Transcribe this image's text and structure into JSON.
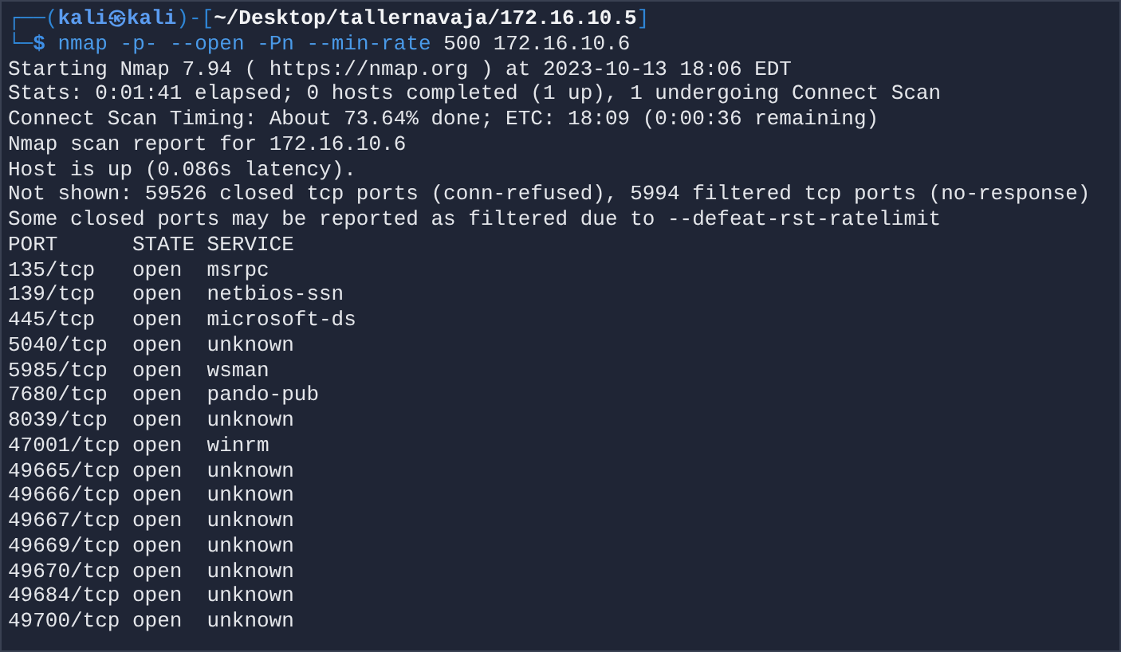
{
  "prompt": {
    "corner_top": "┌──(",
    "user": "kali",
    "at": "㉿",
    "host": "kali",
    "bracket_open": ")-[",
    "path": "~/Desktop/tallernavaja/172.16.10.5",
    "bracket_close": "]",
    "corner_bottom": "└─",
    "symbol": "$"
  },
  "command": {
    "program": "nmap",
    "options": "-p- --open -Pn --min-rate",
    "arguments": "500 172.16.10.6"
  },
  "output": [
    "Starting Nmap 7.94 ( https://nmap.org ) at 2023-10-13 18:06 EDT",
    "Stats: 0:01:41 elapsed; 0 hosts completed (1 up), 1 undergoing Connect Scan",
    "Connect Scan Timing: About 73.64% done; ETC: 18:09 (0:00:36 remaining)",
    "Nmap scan report for 172.16.10.6",
    "Host is up (0.086s latency).",
    "Not shown: 59526 closed tcp ports (conn-refused), 5994 filtered tcp ports (no-response)",
    "Some closed ports may be reported as filtered due to --defeat-rst-ratelimit"
  ],
  "ports": {
    "columns": [
      "PORT",
      "STATE",
      "SERVICE"
    ],
    "rows": [
      [
        "135/tcp",
        "open",
        "msrpc"
      ],
      [
        "139/tcp",
        "open",
        "netbios-ssn"
      ],
      [
        "445/tcp",
        "open",
        "microsoft-ds"
      ],
      [
        "5040/tcp",
        "open",
        "unknown"
      ],
      [
        "5985/tcp",
        "open",
        "wsman"
      ],
      [
        "7680/tcp",
        "open",
        "pando-pub"
      ],
      [
        "8039/tcp",
        "open",
        "unknown"
      ],
      [
        "47001/tcp",
        "open",
        "winrm"
      ],
      [
        "49665/tcp",
        "open",
        "unknown"
      ],
      [
        "49666/tcp",
        "open",
        "unknown"
      ],
      [
        "49667/tcp",
        "open",
        "unknown"
      ],
      [
        "49669/tcp",
        "open",
        "unknown"
      ],
      [
        "49670/tcp",
        "open",
        "unknown"
      ],
      [
        "49684/tcp",
        "open",
        "unknown"
      ],
      [
        "49700/tcp",
        "open",
        "unknown"
      ]
    ]
  }
}
